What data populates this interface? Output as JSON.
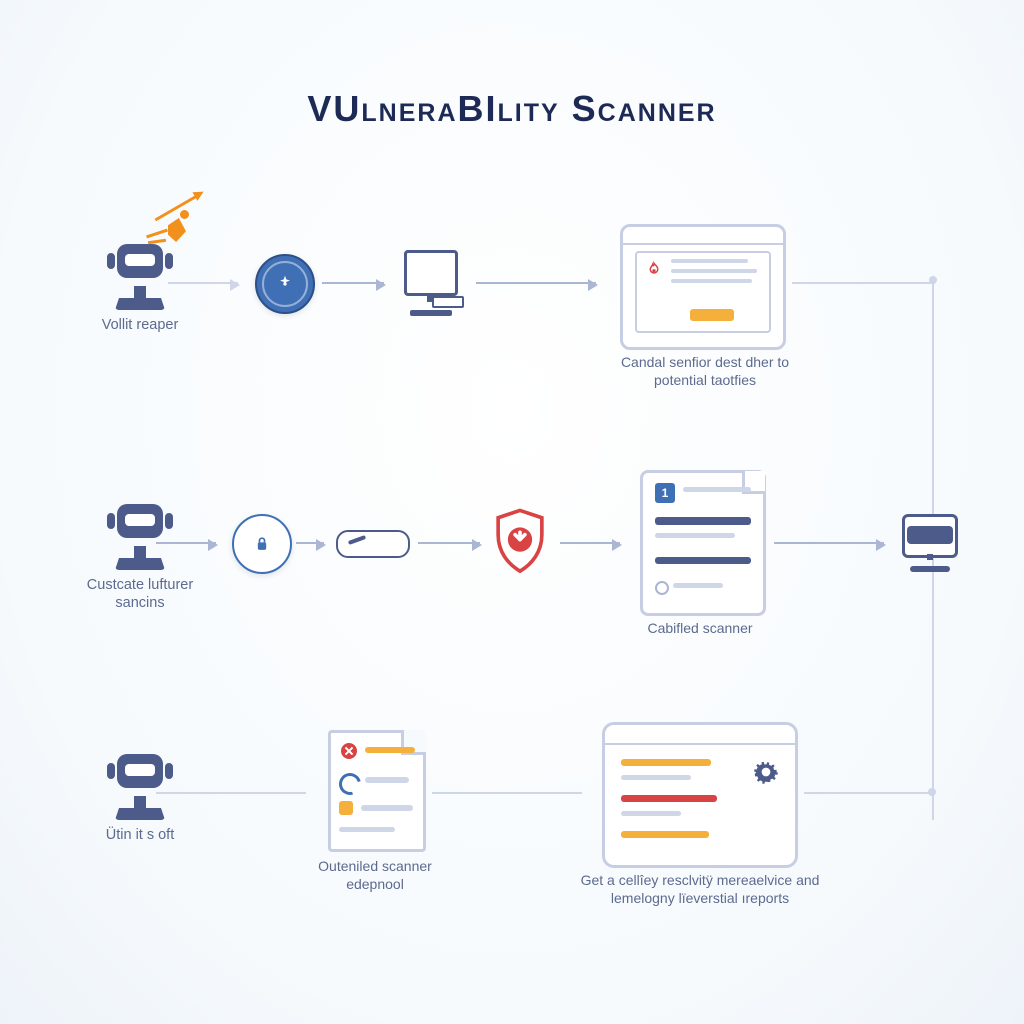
{
  "title": "VUlneraBIlity Scanner",
  "row1": {
    "left_label": "Vollit reaper",
    "right_caption": "Candal senfior dest dher to potential taotfies"
  },
  "row2": {
    "left_label": "Custcate lufturer sancins",
    "badge": "1",
    "card_caption": "Cabifled scanner"
  },
  "row3": {
    "left_label": "Ütin it s oft",
    "doc_caption": "Outeniled scanner edepnool",
    "tablet_caption": "Get a cellîey resclvitÿ mereaelvice and lemelogny lïeverstial ıreports"
  },
  "colors": {
    "navy": "#1e2a56",
    "slate": "#4c5b8a",
    "blue": "#3f6fb5",
    "orange": "#f2901d",
    "red": "#d94343",
    "amber": "#f4b03a"
  }
}
